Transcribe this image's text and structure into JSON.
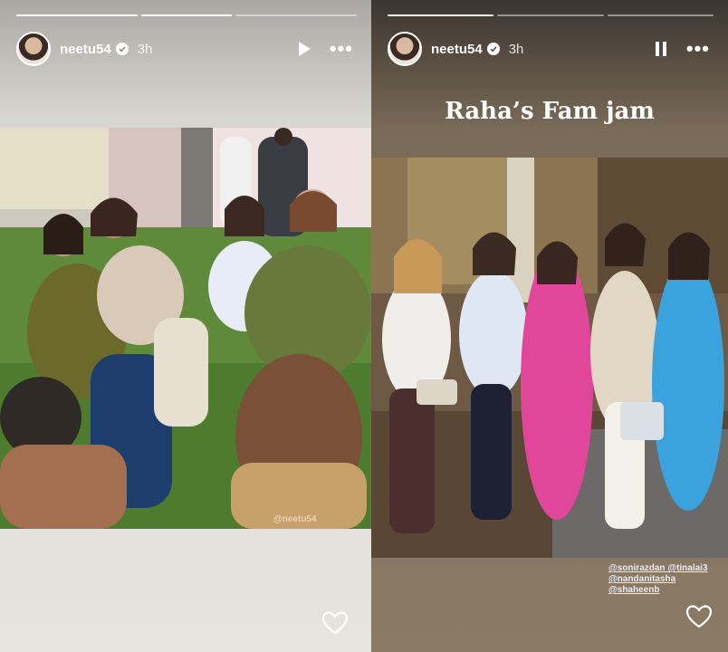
{
  "left_story": {
    "username": "neetu54",
    "time": "3h",
    "progress_done": 1,
    "progress_total": 3,
    "state": "paused",
    "play_icon": "play-icon",
    "more_icon": "more-icon",
    "photo_watermark": "@neetu54"
  },
  "right_story": {
    "username": "neetu54",
    "time": "3h",
    "progress_done": 1,
    "progress_total": 3,
    "state": "playing",
    "pause_icon": "pause-icon",
    "more_icon": "more-icon",
    "caption": "Raha’s Fam jam",
    "tags": [
      "@sonirazdan @tinalai3",
      "@nandanitasha",
      "@shaheenb"
    ]
  },
  "colors": {
    "heart": "#ffffff",
    "verified": "#ffffff"
  }
}
